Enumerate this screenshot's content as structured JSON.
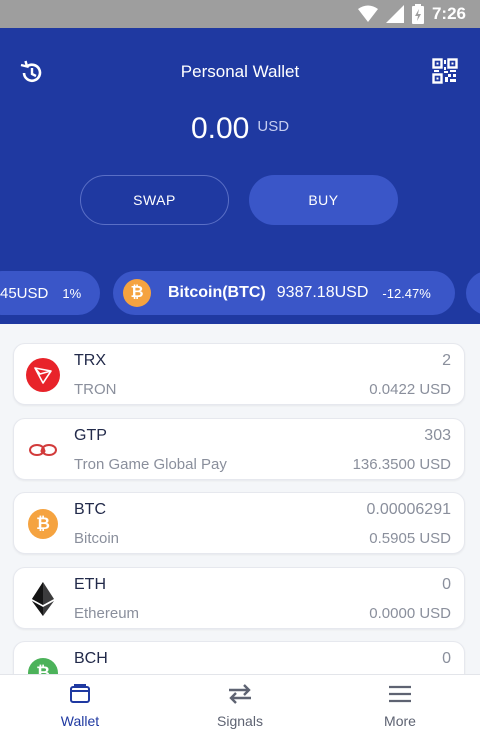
{
  "status_bar": {
    "time": "7:26"
  },
  "header": {
    "title": "Personal Wallet",
    "balance": "0.00",
    "currency": "USD",
    "swap_label": "SWAP",
    "buy_label": "BUY"
  },
  "ticker": {
    "prev": {
      "price": "45USD",
      "change": "1%"
    },
    "current": {
      "coin_glyph": "₿",
      "name": "Bitcoin(BTC)",
      "price": "9387.18USD",
      "change": "-12.47%"
    }
  },
  "assets": [
    {
      "symbol": "TRX",
      "name": "TRON",
      "amount": "2",
      "value": "0.0422 USD",
      "icon": "tron-icon",
      "icon_color": "#e8232a"
    },
    {
      "symbol": "GTP",
      "name": "Tron Game Global Pay",
      "amount": "303",
      "value": "136.3500 USD",
      "icon": "gtp-icon",
      "icon_color": "#d23b3b"
    },
    {
      "symbol": "BTC",
      "name": "Bitcoin",
      "amount": "0.00006291",
      "value": "0.5905 USD",
      "icon": "bitcoin-icon",
      "icon_color": "#f5a340"
    },
    {
      "symbol": "ETH",
      "name": "Ethereum",
      "amount": "0",
      "value": "0.0000 USD",
      "icon": "ethereum-icon",
      "icon_color": "#3c3c3d"
    },
    {
      "symbol": "BCH",
      "name": "",
      "amount": "0",
      "value": "",
      "icon": "bitcoin-cash-icon",
      "icon_color": "#4cb25a"
    }
  ],
  "nav": [
    {
      "label": "Wallet",
      "icon": "wallet-icon",
      "active": true
    },
    {
      "label": "Signals",
      "icon": "swap-arrows-icon",
      "active": false
    },
    {
      "label": "More",
      "icon": "menu-icon",
      "active": false
    }
  ],
  "colors": {
    "primary": "#1f39a1",
    "accent": "#3a56c8",
    "bitcoin": "#f5a340"
  }
}
